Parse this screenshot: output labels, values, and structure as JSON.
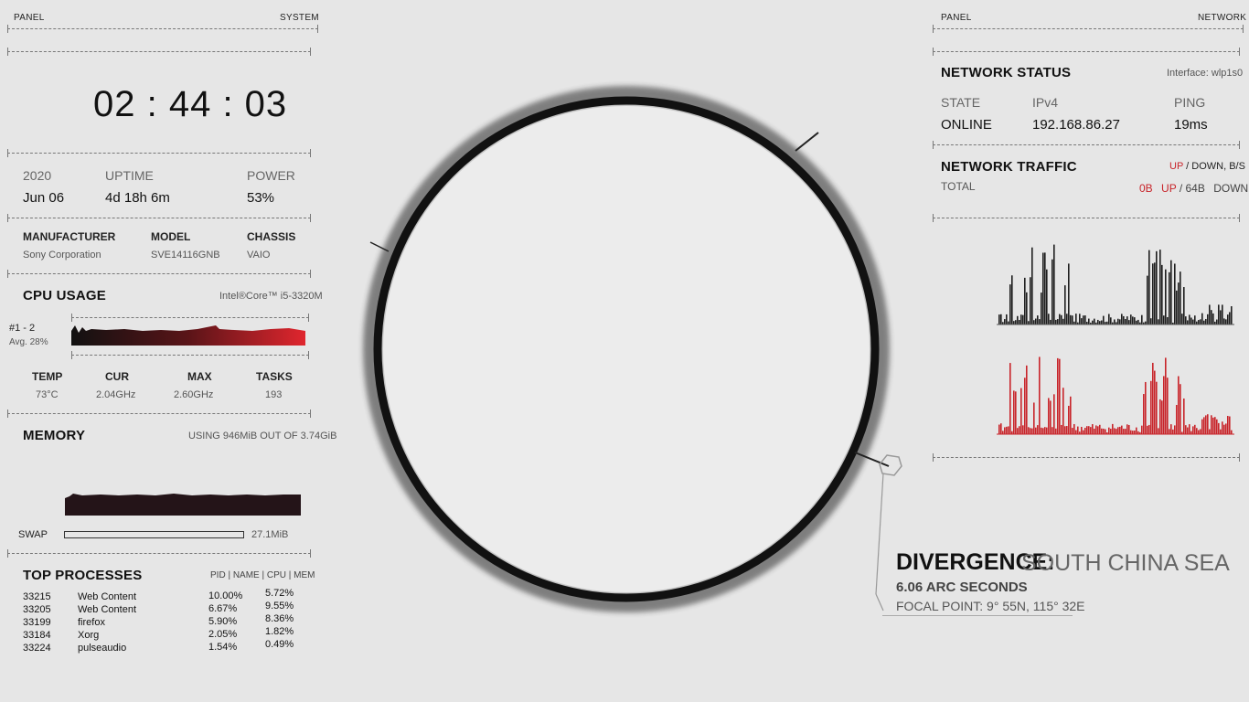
{
  "left": {
    "panel_label": "PANEL",
    "panel_name": "SYSTEM",
    "clock": "02 : 44 : 03",
    "date": {
      "year": "2020",
      "day": "Jun 06"
    },
    "uptime": {
      "label": "UPTIME",
      "value": "4d 18h 6m"
    },
    "power": {
      "label": "POWER",
      "value": "53%"
    },
    "manufacturer": {
      "label": "MANUFACTURER",
      "value": "Sony Corporation"
    },
    "model": {
      "label": "MODEL",
      "value": "SVE14116GNB"
    },
    "chassis": {
      "label": "CHASSIS",
      "value": "VAIO"
    },
    "cpu": {
      "title": "CPU USAGE",
      "name": "Intel®Core™ i5-3320M",
      "cores": "#1 - 2",
      "avg": "Avg. 28%",
      "temp": {
        "label": "TEMP",
        "value": "73°C"
      },
      "cur": {
        "label": "CUR",
        "value": "2.04GHz"
      },
      "max": {
        "label": "MAX",
        "value": "2.60GHz"
      },
      "tasks": {
        "label": "TASKS",
        "value": "193"
      }
    },
    "memory": {
      "title": "MEMORY",
      "using": "USING 946MiB OUT OF 3.74GiB",
      "swap_label": "SWAP",
      "swap_value": "27.1MiB",
      "swap_fraction": 0.0
    },
    "processes": {
      "title": "TOP PROCESSES",
      "header": "PID | NAME | CPU | MEM",
      "rows": [
        {
          "pid": "33215",
          "name": "Web Content",
          "cpu": "10.00%",
          "mem": "5.72%"
        },
        {
          "pid": "33205",
          "name": "Web Content",
          "cpu": "6.67%",
          "mem": "9.55%"
        },
        {
          "pid": "33199",
          "name": "firefox",
          "cpu": "5.90%",
          "mem": "8.36%"
        },
        {
          "pid": "33184",
          "name": "Xorg",
          "cpu": "2.05%",
          "mem": "1.82%"
        },
        {
          "pid": "33224",
          "name": "pulseaudio",
          "cpu": "1.54%",
          "mem": "0.49%"
        }
      ]
    }
  },
  "right": {
    "panel_label": "PANEL",
    "panel_name": "NETWORK",
    "status_title": "NETWORK STATUS",
    "interface": "Interface: wlp1s0",
    "state": {
      "label": "STATE",
      "value": "ONLINE"
    },
    "ipv4": {
      "label": "IPv4",
      "value": "192.168.86.27"
    },
    "ping": {
      "label": "PING",
      "value": "19ms"
    },
    "traffic_title": "NETWORK TRAFFIC",
    "traffic_legend_up": "UP",
    "traffic_legend_rest": " / DOWN, B/S",
    "total_label": "TOTAL",
    "total_up_value": "0B",
    "total_up_label": "UP",
    "total_down_value": "/ 64B",
    "total_down_label": "DOWN"
  },
  "center": {
    "divergence_label": "DIVERGENCE:",
    "divergence_place": "SOUTH CHINA SEA",
    "arc": "6.06 ARC SECONDS",
    "focal": "FOCAL POINT: 9° 55N, 115° 32E"
  },
  "colors": {
    "accent": "#c8242a",
    "dark": "#1a1a1a",
    "bg": "#e6e6e6"
  }
}
